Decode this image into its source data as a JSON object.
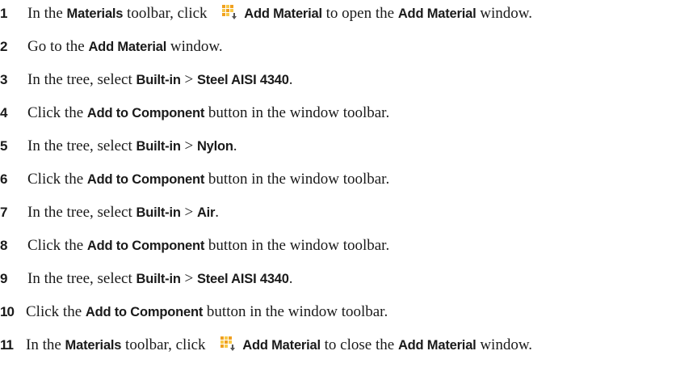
{
  "steps": [
    {
      "num": "1",
      "pre": "In the ",
      "b1": "Materials",
      "mid": " toolbar, click ",
      "icon": "add-material-icon",
      "b2": "Add Material",
      "post": " to open the ",
      "b3": "Add Material",
      "end": " window."
    },
    {
      "num": "2",
      "pre": "Go to the ",
      "b1": "Add Material",
      "post": " window."
    },
    {
      "num": "3",
      "pre": "In the tree, select ",
      "b1": "Built-in",
      "sep": " > ",
      "b2": "Steel AISI 4340",
      "post": "."
    },
    {
      "num": "4",
      "pre": "Click the ",
      "b1": "Add to Component",
      "post": " button in the window toolbar."
    },
    {
      "num": "5",
      "pre": "In the tree, select ",
      "b1": "Built-in",
      "sep": " > ",
      "b2": "Nylon",
      "post": "."
    },
    {
      "num": "6",
      "pre": "Click the ",
      "b1": "Add to Component",
      "post": " button in the window toolbar."
    },
    {
      "num": "7",
      "pre": "In the tree, select ",
      "b1": "Built-in",
      "sep": " > ",
      "b2": "Air",
      "post": "."
    },
    {
      "num": "8",
      "pre": "Click the ",
      "b1": "Add to Component",
      "post": " button in the window toolbar."
    },
    {
      "num": "9",
      "pre": "In the tree, select ",
      "b1": "Built-in",
      "sep": " > ",
      "b2": "Steel AISI 4340",
      "post": "."
    },
    {
      "num": "10",
      "pre": "Click the ",
      "b1": "Add to Component",
      "post": " button in the window toolbar."
    },
    {
      "num": "11",
      "pre": "In the ",
      "b1": "Materials",
      "mid": " toolbar, click ",
      "icon": "add-material-icon",
      "b2": "Add Material",
      "post": " to close the ",
      "b3": "Add Material",
      "end": " window."
    }
  ],
  "colors": {
    "text": "#1a1a1a",
    "icon_orange": "#f0a020",
    "icon_yellow": "#f7c948",
    "icon_arrow": "#555555"
  }
}
